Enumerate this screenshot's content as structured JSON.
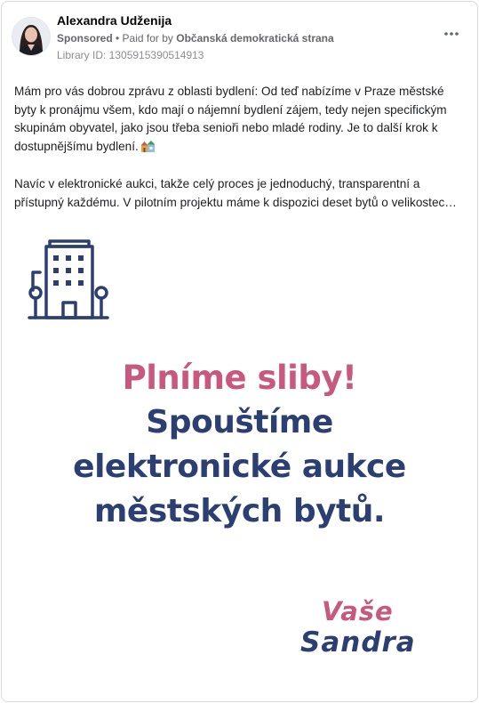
{
  "post": {
    "page_name": "Alexandra Udženija",
    "sponsored_label": "Sponsored",
    "paid_for_prefix": " • Paid for by ",
    "payer": "Občanská demokratická strana",
    "library_id": "Library ID: 1305915390514913",
    "more_icon": "more-horizontal-icon",
    "paragraph_1": "Mám pro vás dobrou zprávu z oblasti bydlení: Od teď nabízíme v Praze městské byty k pronájmu všem, kdo mají o nájemní bydlení zájem, tedy nejen specifickým skupinám obyvatel, jako jsou třeba senioři nebo mladé rodiny. Je to další krok k dostupnějšímu bydlení.",
    "paragraph_1_emoji": "houses-emoji",
    "paragraph_2": "Navíc v elektronické aukci, takže celý proces je jednoduchý, transparentní a přístupný každému. V pilotním projektu máme k dispozici deset bytů o velikostec…"
  },
  "ad_image": {
    "headline_1": "Plníme sliby!",
    "headline_2": "Spouštíme",
    "headline_3": "elektronické aukce",
    "headline_4": "městských bytů.",
    "signature_1": "Vaše",
    "signature_2": "Sandra",
    "icon": "apartment-building-icon",
    "colors": {
      "pink": "#c9587e",
      "navy": "#2b3f72"
    }
  }
}
